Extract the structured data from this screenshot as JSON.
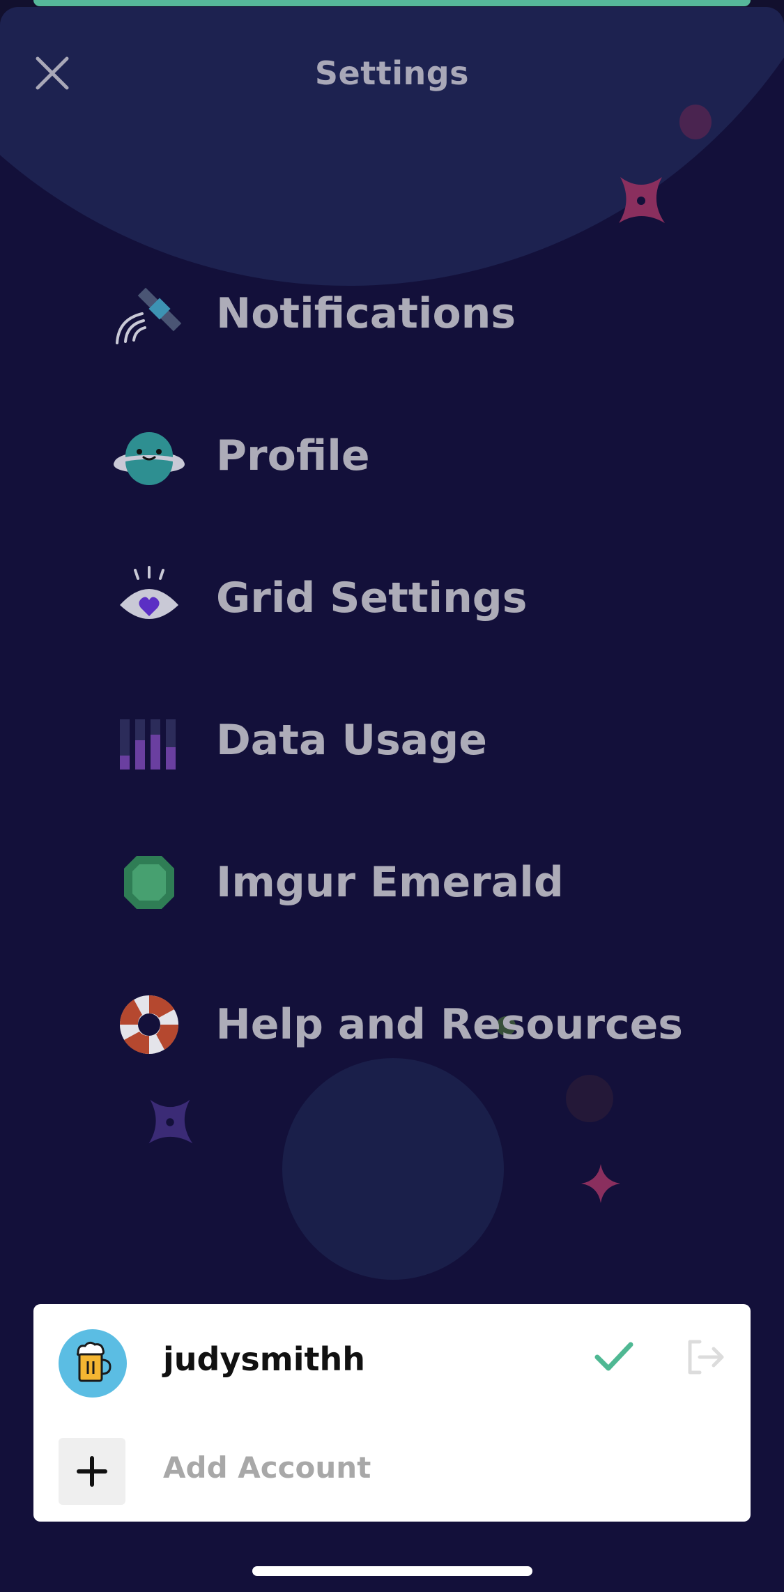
{
  "header": {
    "title": "Settings",
    "close_icon": "close-icon"
  },
  "menu": [
    {
      "label": "Notifications",
      "icon": "satellite-icon"
    },
    {
      "label": "Profile",
      "icon": "planet-face-icon"
    },
    {
      "label": "Grid Settings",
      "icon": "eye-heart-icon"
    },
    {
      "label": "Data Usage",
      "icon": "bar-chart-icon"
    },
    {
      "label": "Imgur Emerald",
      "icon": "emerald-icon"
    },
    {
      "label": "Help and Resources",
      "icon": "lifebuoy-icon"
    }
  ],
  "accounts": {
    "current": {
      "username": "judysmithh",
      "avatar_icon": "beer-mug-avatar",
      "active": true
    },
    "add_label": "Add Account"
  },
  "colors": {
    "background": "#13103a",
    "accent_green": "#4fb893",
    "card": "#ffffff",
    "menu_text": "#adacb8"
  }
}
